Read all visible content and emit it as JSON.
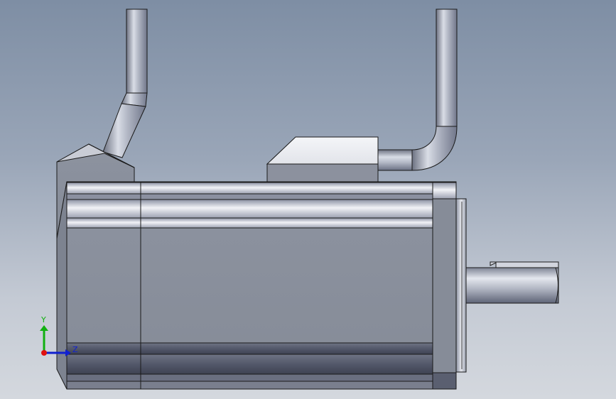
{
  "viewport": {
    "background_top": "#7e8ea4",
    "background_bottom": "#d4d8de"
  },
  "model": {
    "body_color": "#878d99",
    "edge_color": "#1a1a1a",
    "shaft_color": "#aeb4c2"
  },
  "triad": {
    "x_axis_color": "#e01010",
    "y_axis_color": "#10b010",
    "z_axis_color": "#1020d0",
    "y_label": "Y",
    "z_label": "Z"
  }
}
